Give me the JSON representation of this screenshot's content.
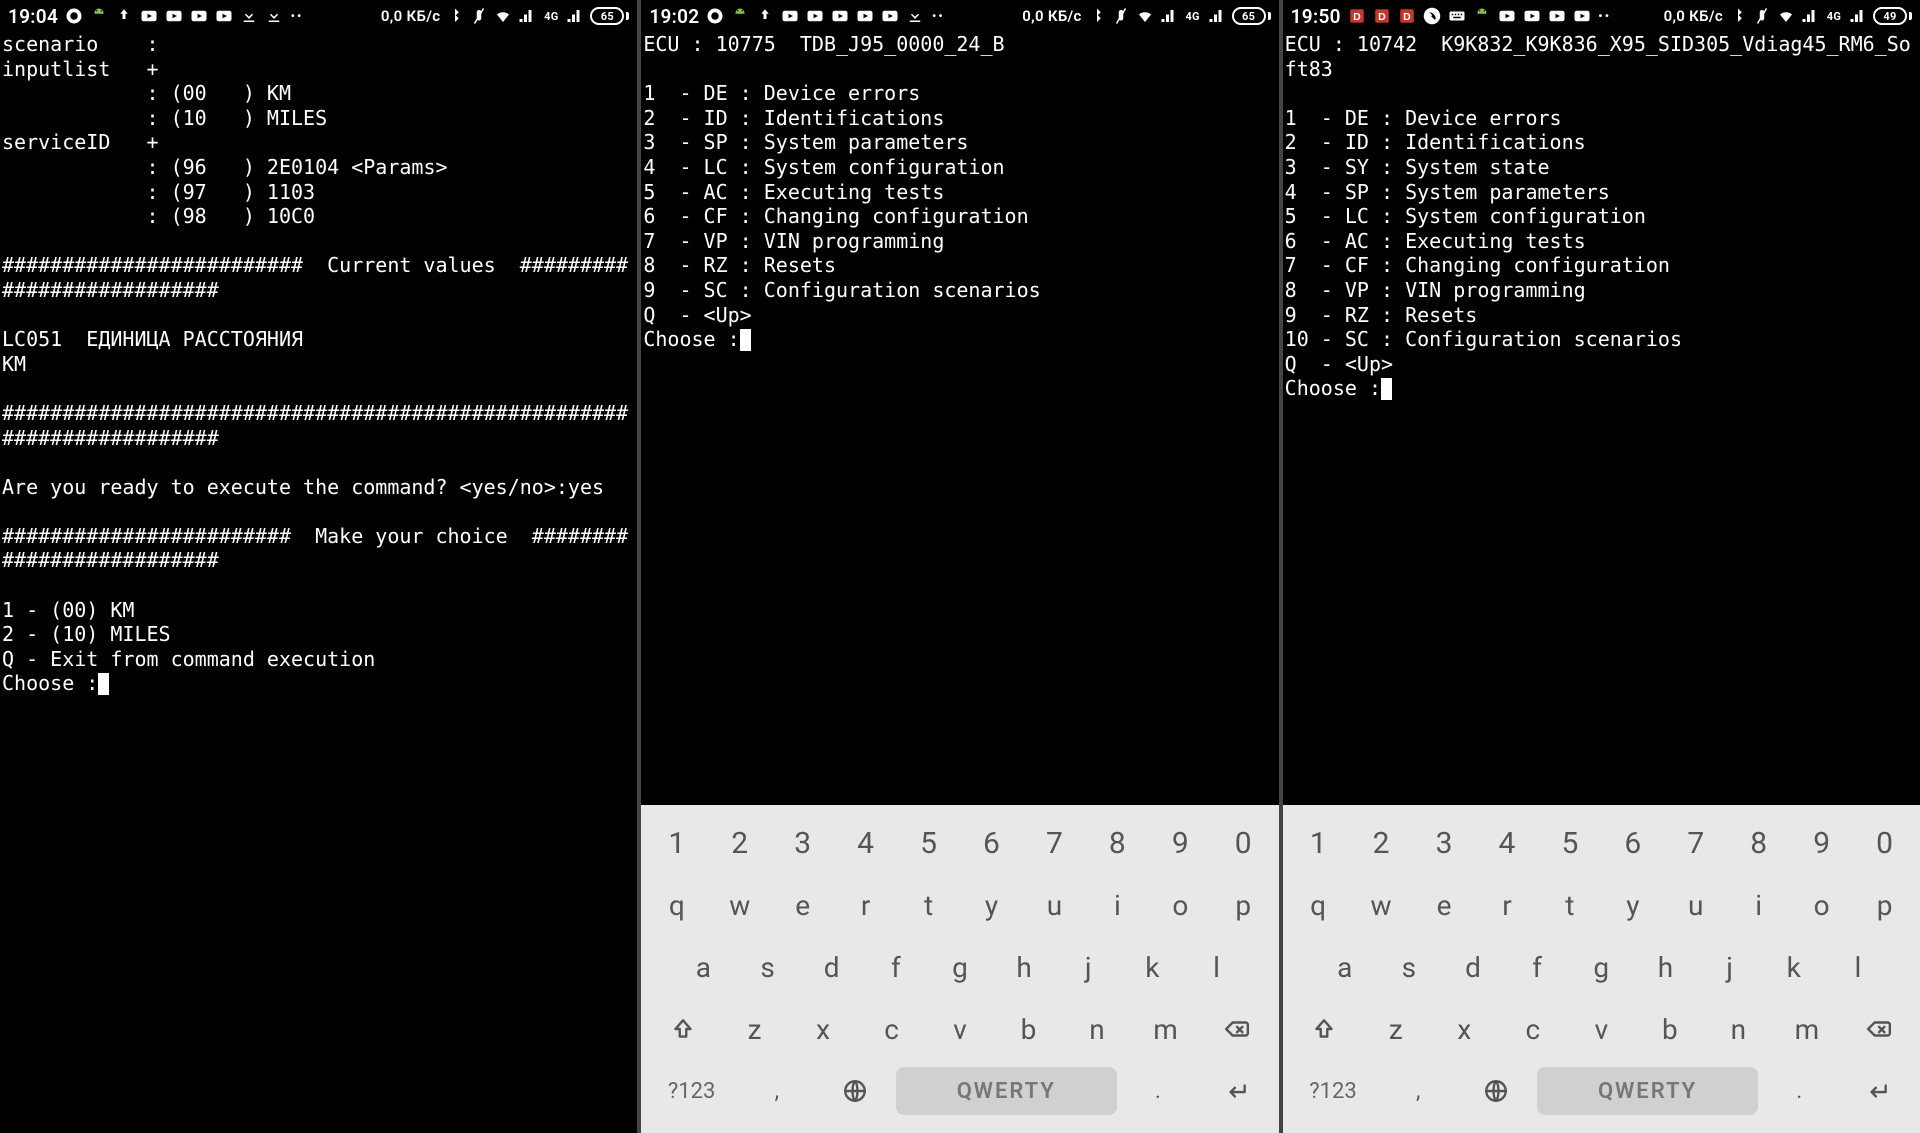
{
  "screens": [
    {
      "status": {
        "time": "19:04",
        "net": "0,0 КБ/с",
        "battery": "65",
        "left_icons": [
          "msg",
          "android",
          "upload",
          "yt",
          "yt",
          "yt",
          "yt",
          "dl",
          "dl"
        ],
        "right_icons": [
          "bt",
          "mute",
          "wifi",
          "sig",
          "4g",
          "sig"
        ]
      },
      "term_lines": [
        "scenario    :",
        "inputlist   +",
        "            : (00   ) KM",
        "            : (10   ) MILES",
        "serviceID   +",
        "            : (96   ) 2E0104 <Params>",
        "            : (97   ) 1103",
        "            : (98   ) 10C0",
        "",
        "#########################  Current values  ###########################",
        "",
        "LC051  ЕДИНИЦА РАССТОЯНИЯ",
        "KM",
        "",
        "######################################################################",
        "",
        "Are you ready to execute the command? <yes/no>:yes",
        "",
        "########################  Make your choice  ##########################",
        "",
        "1 - (00) KM",
        "2 - (10) MILES",
        "Q - Exit from command execution"
      ],
      "prompt": "Choose :",
      "keyboard": false
    },
    {
      "status": {
        "time": "19:02",
        "net": "0,0 КБ/с",
        "battery": "65",
        "left_icons": [
          "msg",
          "android",
          "upload",
          "yt",
          "yt",
          "yt",
          "yt",
          "yt",
          "dl"
        ],
        "right_icons": [
          "bt",
          "mute",
          "wifi",
          "sig",
          "4g",
          "sig"
        ],
        "left_dots": true
      },
      "ecu_id": "10775",
      "ecu_name": "TDB_J95_0000_24_B",
      "menu": [
        {
          "n": "1",
          "c": "DE",
          "t": "Device errors"
        },
        {
          "n": "2",
          "c": "ID",
          "t": "Identifications"
        },
        {
          "n": "3",
          "c": "SP",
          "t": "System parameters"
        },
        {
          "n": "4",
          "c": "LC",
          "t": "System configuration"
        },
        {
          "n": "5",
          "c": "AC",
          "t": "Executing tests"
        },
        {
          "n": "6",
          "c": "CF",
          "t": "Changing configuration"
        },
        {
          "n": "7",
          "c": "VP",
          "t": "VIN programming"
        },
        {
          "n": "8",
          "c": "RZ",
          "t": "Resets"
        },
        {
          "n": "9",
          "c": "SC",
          "t": "Configuration scenarios"
        },
        {
          "n": "Q",
          "c": "",
          "t": "<Up>"
        }
      ],
      "prompt": "Choose :",
      "keyboard": true
    },
    {
      "status": {
        "time": "19:50",
        "net": "0,0 КБ/с",
        "battery": "49",
        "left_icons_red": [
          "D",
          "D",
          "D"
        ],
        "left_icons": [
          "viber",
          "kb",
          "android",
          "yt",
          "yt",
          "yt",
          "yt"
        ],
        "right_icons": [
          "bt",
          "mute",
          "wifi",
          "sig",
          "4g",
          "sig"
        ]
      },
      "ecu_id": "10742",
      "ecu_name": "K9K832_K9K836_X95_SID305_Vdiag45_RM6_Soft83",
      "menu": [
        {
          "n": "1",
          "c": "DE",
          "t": "Device errors"
        },
        {
          "n": "2",
          "c": "ID",
          "t": "Identifications"
        },
        {
          "n": "3",
          "c": "SY",
          "t": "System state"
        },
        {
          "n": "4",
          "c": "SP",
          "t": "System parameters"
        },
        {
          "n": "5",
          "c": "LC",
          "t": "System configuration"
        },
        {
          "n": "6",
          "c": "AC",
          "t": "Executing tests"
        },
        {
          "n": "7",
          "c": "CF",
          "t": "Changing configuration"
        },
        {
          "n": "8",
          "c": "VP",
          "t": "VIN programming"
        },
        {
          "n": "9",
          "c": "RZ",
          "t": "Resets"
        },
        {
          "n": "10",
          "c": "SC",
          "t": "Configuration scenarios"
        },
        {
          "n": "Q",
          "c": "",
          "t": "<Up>"
        }
      ],
      "prompt": "Choose :",
      "keyboard": true
    }
  ],
  "keyboard": {
    "nums": [
      "1",
      "2",
      "3",
      "4",
      "5",
      "6",
      "7",
      "8",
      "9",
      "0"
    ],
    "row2": [
      "q",
      "w",
      "e",
      "r",
      "t",
      "y",
      "u",
      "i",
      "o",
      "p"
    ],
    "row3": [
      "a",
      "s",
      "d",
      "f",
      "g",
      "h",
      "j",
      "k",
      "l"
    ],
    "row4": [
      "z",
      "x",
      "c",
      "v",
      "b",
      "n",
      "m"
    ],
    "sym": "?123",
    "space": "QWERTY"
  }
}
